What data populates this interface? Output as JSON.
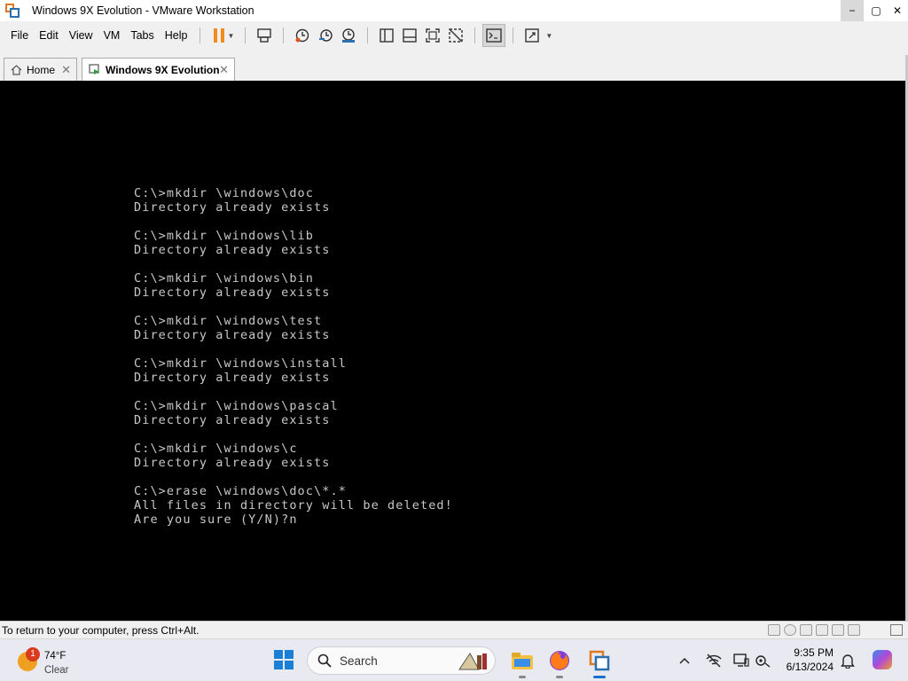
{
  "window": {
    "title": "Windows 9X Evolution - VMware Workstation",
    "controls": {
      "minimize": "−",
      "maximize": "▢",
      "close": "✕"
    }
  },
  "menubar": {
    "items": [
      "File",
      "Edit",
      "View",
      "VM",
      "Tabs",
      "Help"
    ]
  },
  "toolbar": {
    "icons": [
      "pause-icon",
      "send-ctrl-alt-del-icon",
      "snapshot-icon",
      "revert-snapshot-icon",
      "snapshot-manager-icon",
      "sidebar-icon",
      "thumbnail-bar-icon",
      "full-screen-icon",
      "unity-icon",
      "console-view-icon",
      "stretch-icon"
    ],
    "accent": "#f28a1e"
  },
  "tabs": [
    {
      "label": "Home",
      "icon": "home-icon",
      "active": false
    },
    {
      "label": "Windows 9X Evolution",
      "icon": "vm-icon",
      "active": true
    }
  ],
  "console": {
    "lines": [
      "C:\\>mkdir \\windows\\doc",
      "Directory already exists",
      "",
      "C:\\>mkdir \\windows\\lib",
      "Directory already exists",
      "",
      "C:\\>mkdir \\windows\\bin",
      "Directory already exists",
      "",
      "C:\\>mkdir \\windows\\test",
      "Directory already exists",
      "",
      "C:\\>mkdir \\windows\\install",
      "Directory already exists",
      "",
      "C:\\>mkdir \\windows\\pascal",
      "Directory already exists",
      "",
      "C:\\>mkdir \\windows\\c",
      "Directory already exists",
      "",
      "C:\\>erase \\windows\\doc\\*.*",
      "All files in directory will be deleted!",
      "Are you sure (Y/N)?n"
    ],
    "background": "#000000",
    "foreground": "#c8c8c8"
  },
  "statusbar": {
    "message": "To return to your computer, press Ctrl+Alt."
  },
  "taskbar": {
    "weather": {
      "temperature": "74°F",
      "condition": "Clear",
      "badge": "1"
    },
    "search_label": "Search",
    "apps": [
      "file-explorer-icon",
      "firefox-icon",
      "vmware-icon"
    ],
    "tray_icons": [
      "chevron-up-icon",
      "network-icon",
      "display-icon",
      "settings-icon",
      "notification-bell-icon"
    ],
    "time": "9:35 PM",
    "date": "6/13/2024"
  }
}
